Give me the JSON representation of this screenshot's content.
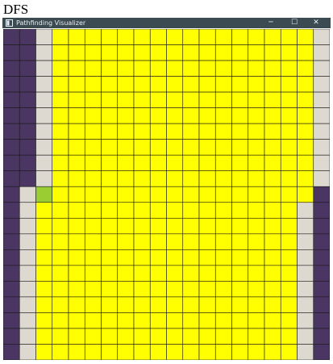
{
  "caption": "DFS",
  "window": {
    "title": "Pathfinding Visualizer",
    "controls": {
      "minimize": "─",
      "maximize": "☐",
      "close": "✕"
    }
  },
  "grid": {
    "cols": 20,
    "rows": 21,
    "colors": {
      "visited": "#ffff00",
      "open": "#ddd8d0",
      "wall": "#4b3563",
      "current": "#9acd32",
      "line": "#1a1a1a"
    },
    "cell_states": [
      "WWoVVVVVVVVVVVVVVVVo",
      "WWoVVVVVVVVVVVVVVVVo",
      "WWoVVVVVVVVVVVVVVVVo",
      "WWoVVVVVVVVVVVVVVVVo",
      "WWoVVVVVVVVVVVVVVVVo",
      "WWoVVVVVVVVVVVVVVVVo",
      "WWoVVVVVVVVVVVVVVVVo",
      "WWoVVVVVVVVVVVVVVVVo",
      "WWoVVVVVVVVVVVVVVVVo",
      "WWoVVVVVVVVVVVVVVVVo",
      "WoCVVVVVVVVVVVVVVVVW",
      "WoVVVVVVVVVVVVVVVVoW",
      "WoVVVVVVVVVVVVVVVVoW",
      "WoVVVVVVVVVVVVVVVVoW",
      "WoVVVVVVVVVVVVVVVVoW",
      "WoVVVVVVVVVVVVVVVVoW",
      "WoVVVVVVVVVVVVVVVVoW",
      "WoVVVVVVVVVVVVVVVVoW",
      "WoVVVVVVVVVVVVVVVVoW",
      "WoVVVVVVVVVVVVVVVVoW",
      "WoVVVVVVVVVVVVVVVVoW"
    ]
  }
}
